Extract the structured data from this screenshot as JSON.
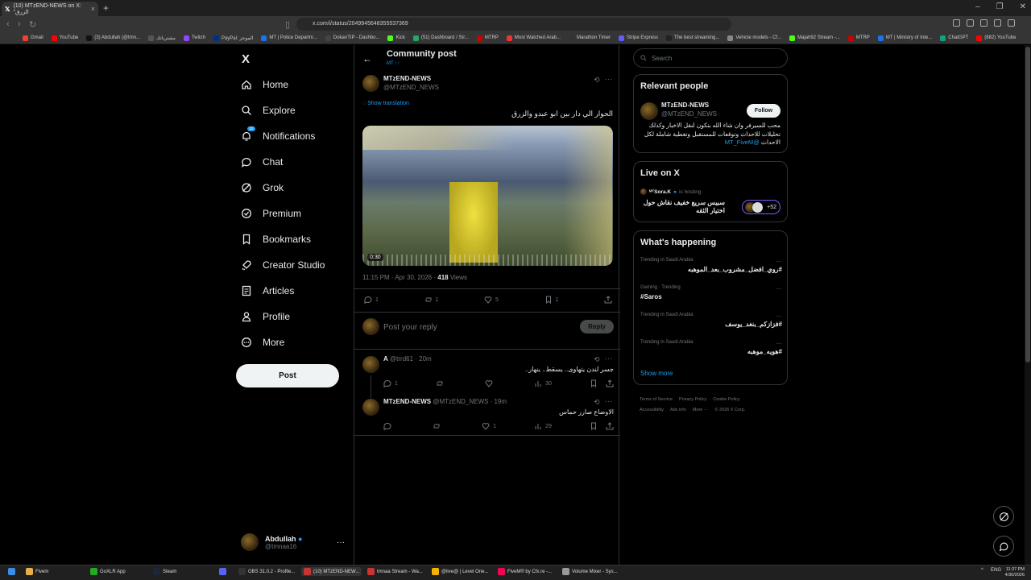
{
  "browser": {
    "tab_title": "(10) MTzEND-NEWS on X: \"الزرق",
    "url": "x.com/i/status/2049945648355537369",
    "bookmarks": [
      "Gmail",
      "YouTube",
      "(3) Abdullah (@tmn...",
      "مشترياتك",
      "Twitch",
      "PayPal: الموجز",
      "MT | Police Departm...",
      "DokanTIP - Dashbo...",
      "Kick",
      "(51) Dashboard / Str...",
      "MTRP",
      "Most Watched Arab...",
      "Marathon Timer",
      "Stripe Express",
      "The best streaming...",
      "Vehicle models - Cf...",
      "Majah92 Stream -...",
      "MTRP",
      "MT | Ministry of Inte...",
      "ChatGPT",
      "(882) YouTube"
    ],
    "colors": {
      "bg": "#000000",
      "accent": "#1d9bf0",
      "border": "#2f3336",
      "muted": "#71767b"
    }
  },
  "sidebar": {
    "logo": "X",
    "items": [
      {
        "label": "Home",
        "icon": "home-icon"
      },
      {
        "label": "Explore",
        "icon": "search-icon"
      },
      {
        "label": "Notifications",
        "icon": "bell-icon",
        "badge": "10"
      },
      {
        "label": "Chat",
        "icon": "chat-icon"
      },
      {
        "label": "Grok",
        "icon": "grok-icon"
      },
      {
        "label": "Premium",
        "icon": "premium-icon"
      },
      {
        "label": "Bookmarks",
        "icon": "bookmark-icon"
      },
      {
        "label": "Creator Studio",
        "icon": "rocket-icon"
      },
      {
        "label": "Articles",
        "icon": "article-icon"
      },
      {
        "label": "Profile",
        "icon": "person-icon"
      },
      {
        "label": "More",
        "icon": "more-circle-icon"
      }
    ],
    "post_label": "Post",
    "account": {
      "name": "Abdullah",
      "handle": "@tmnaa16"
    }
  },
  "main": {
    "header": {
      "title": "Community post",
      "subtitle": "MT ↑↑"
    },
    "post": {
      "author": "MTzEND-NEWS",
      "handle": "@MTzEND_NEWS",
      "show_translation": "Show translation",
      "text": "الحوار الي دار بين ابو عبدو والزرق",
      "video_duration": "0:30",
      "timestamp": "11:15 PM · Apr 30, 2026 · ",
      "views_count": "418",
      "views_label": " Views",
      "replies": "1",
      "reposts": "1",
      "likes": "5",
      "bookmarks": "1"
    },
    "reply_box": {
      "placeholder": "Post your reply",
      "button": "Reply"
    },
    "replies": [
      {
        "name": "A",
        "meta": "@trrd61 · 20m",
        "text": "جسر لندن يتهاوى.. يسقط.. ينهار..",
        "replies": "1",
        "reposts": "",
        "likes": "",
        "views": "30"
      },
      {
        "name": "MTzEND-NEWS",
        "meta": "@MTzEND_NEWS · 19m",
        "text": "الاوضاع صارر حماس",
        "replies": "",
        "reposts": "",
        "likes": "1",
        "views": "29"
      }
    ]
  },
  "right": {
    "search_placeholder": "Search",
    "relevant": {
      "title": "Relevant people",
      "name": "MTzEND-NEWS",
      "handle": "@MTzEND_NEWS",
      "follow_label": "Follow",
      "bio": "محب للسيرفر وان شاء الله بنكون لنقل الاخبار وكذلك تحليلات للاحداث وتوقعات للمستقبل وتغطية شاملة لكل الاحداث",
      "bio_mention": "@MT_FiveM"
    },
    "live": {
      "title": "Live on X",
      "host": "ᴹᵀSora.K",
      "hosting_label": "is hosting",
      "space_title": "سبيس سريع خفيف نقاش حول اختيار الثقه",
      "listeners": "+52"
    },
    "happening": {
      "title": "What's happening",
      "trends": [
        {
          "category": "Trending in Saudi Arabia",
          "tag": "#روي_افضل_مشروب_بعد_الموهبه"
        },
        {
          "category": "Gaming · Trending",
          "tag": "#Saros"
        },
        {
          "category": "Trending in Saudi Arabia",
          "tag": "#فزازكم_بنغد_يوسف"
        },
        {
          "category": "Trending in Saudi Arabia",
          "tag": "#هويه_موهبه"
        }
      ],
      "show_more": "Show more"
    },
    "footer": [
      "Terms of Service",
      "Privacy Policy",
      "Cookie Policy",
      "Accessibility",
      "Ads info",
      "More ···",
      "© 2026 X Corp."
    ]
  },
  "taskbar": {
    "items": [
      "Fivem",
      "GoXLR App",
      "Steam",
      "",
      "OBS 31.0.2 - Profile...",
      "(10) MTzEND-NEW...",
      "tmnaa Stream - Wa...",
      "@live@ | Level One...",
      "FiveM® by Cfx.re -...",
      "Volume Mixer - Sys..."
    ],
    "lang": "ENG",
    "time": "11:37 PM",
    "date": "4/30/2026"
  }
}
